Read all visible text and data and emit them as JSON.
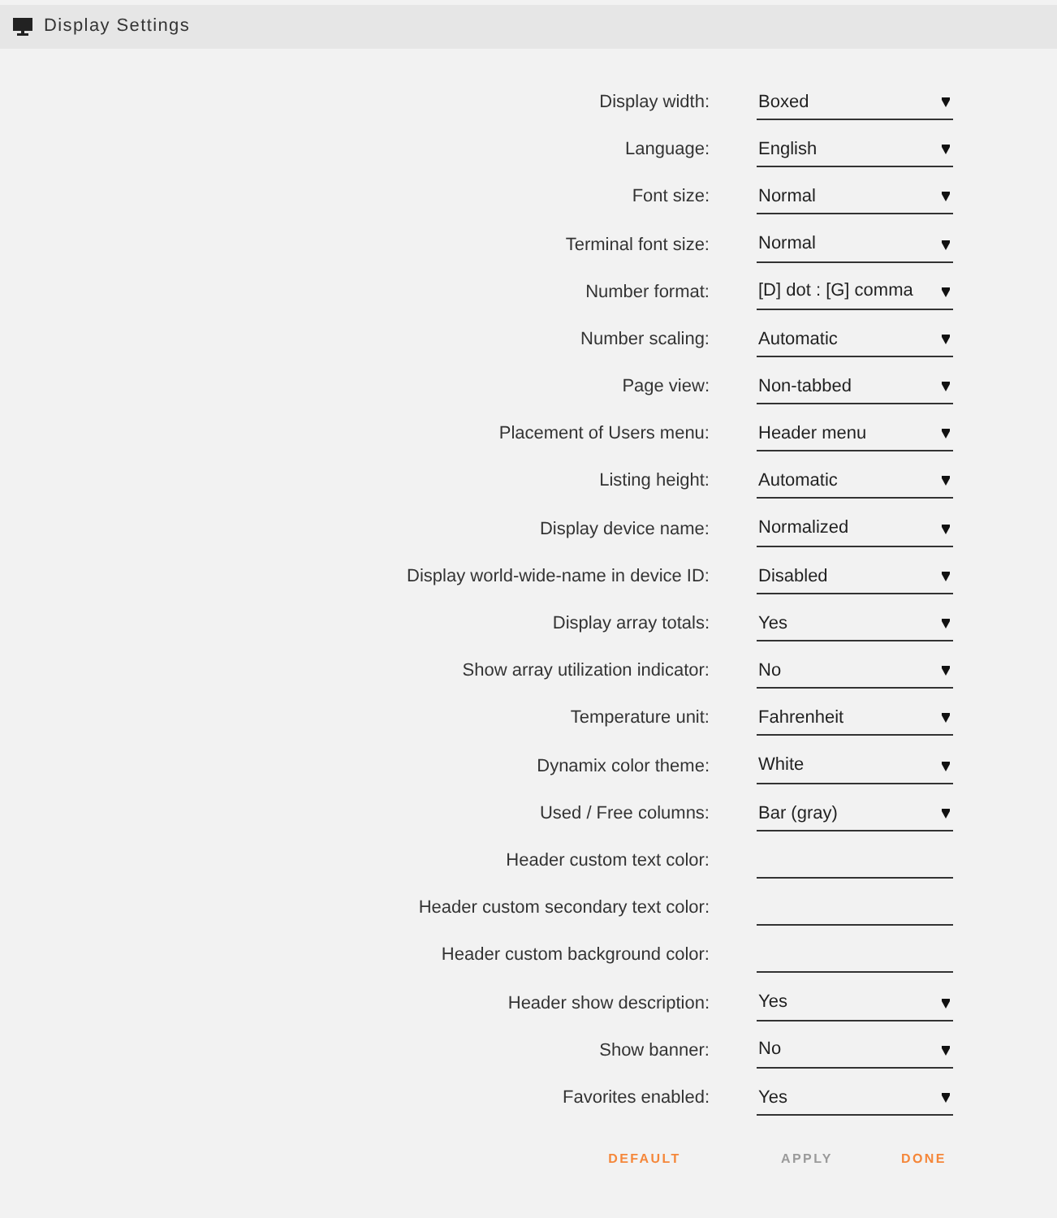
{
  "panel": {
    "title": "Display Settings"
  },
  "settings": [
    {
      "label": "Display width:",
      "kind": "select",
      "value": "Boxed"
    },
    {
      "label": "Language:",
      "kind": "select",
      "value": "English"
    },
    {
      "label": "Font size:",
      "kind": "select",
      "value": "Normal"
    },
    {
      "label": "Terminal font size:",
      "kind": "select",
      "value": "Normal"
    },
    {
      "label": "Number format:",
      "kind": "select",
      "value": "[D] dot : [G] comma"
    },
    {
      "label": "Number scaling:",
      "kind": "select",
      "value": "Automatic"
    },
    {
      "label": "Page view:",
      "kind": "select",
      "value": "Non-tabbed"
    },
    {
      "label": "Placement of Users menu:",
      "kind": "select",
      "value": "Header menu"
    },
    {
      "label": "Listing height:",
      "kind": "select",
      "value": "Automatic"
    },
    {
      "label": "Display device name:",
      "kind": "select",
      "value": "Normalized"
    },
    {
      "label": "Display world-wide-name in device ID:",
      "kind": "select",
      "value": "Disabled"
    },
    {
      "label": "Display array totals:",
      "kind": "select",
      "value": "Yes"
    },
    {
      "label": "Show array utilization indicator:",
      "kind": "select",
      "value": "No"
    },
    {
      "label": "Temperature unit:",
      "kind": "select",
      "value": "Fahrenheit"
    },
    {
      "label": "Dynamix color theme:",
      "kind": "select",
      "value": "White"
    },
    {
      "label": "Used / Free columns:",
      "kind": "select",
      "value": "Bar (gray)"
    },
    {
      "label": "Header custom text color:",
      "kind": "text"
    },
    {
      "label": "Header custom secondary text color:",
      "kind": "text"
    },
    {
      "label": "Header custom background color:",
      "kind": "text"
    },
    {
      "label": "Header show description:",
      "kind": "select",
      "value": "Yes"
    },
    {
      "label": "Show banner:",
      "kind": "select",
      "value": "No"
    },
    {
      "label": "Favorites enabled:",
      "kind": "select",
      "value": "Yes"
    }
  ],
  "buttons": [
    {
      "label": "DEFAULT",
      "disabled": false
    },
    {
      "label": "APPLY",
      "disabled": true
    },
    {
      "label": "DONE",
      "disabled": false
    }
  ]
}
